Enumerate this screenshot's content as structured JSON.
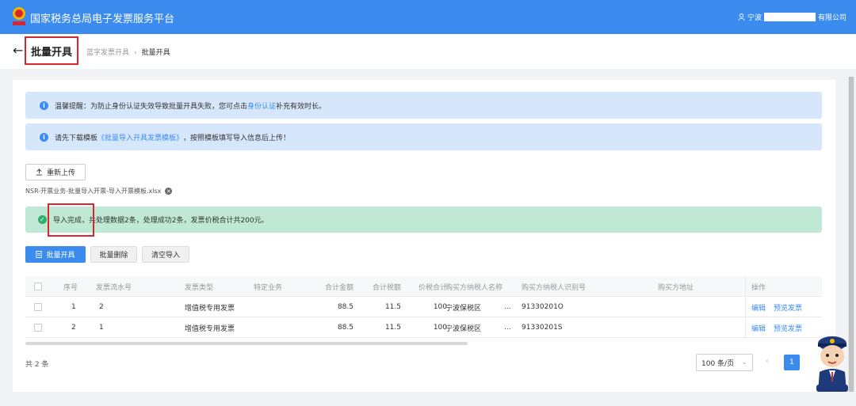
{
  "header": {
    "app_title": "国家税务总局电子发票服务平台",
    "user_prefix": "宁波",
    "user_suffix": "有限公司"
  },
  "subheader": {
    "back_icon": "←",
    "page_title": "批量开具",
    "breadcrumb": [
      "蓝字发票开具",
      "批量开具"
    ]
  },
  "alerts": {
    "tip_prefix": "温馨提醒：为防止身份认证失效导致批量开具失败，您可点击",
    "tip_link": "身份认证",
    "tip_suffix": "补充有效时长。",
    "template_prefix": "请先下载模板",
    "template_link": "《批量导入开具发票模板》",
    "template_suffix": "，按照模板填写导入信息后上传！"
  },
  "upload": {
    "reupload_label": "重新上传",
    "filename": "NSR-开票业务-批量导入开票-导入开票模板.xlsx"
  },
  "import_result": {
    "message": "导入完成，共处理数据2条，处理成功2条，发票价税合计共200元。"
  },
  "actions": {
    "batch_issue": "批量开具",
    "batch_delete": "批量删除",
    "clear_import": "清空导入"
  },
  "table": {
    "headers": [
      "序号",
      "发票流水号",
      "发票类型",
      "特定业务",
      "合计金额",
      "合计税额",
      "价税合计",
      "购买方纳税人名称",
      "购买方纳税人识别号",
      "购买方地址",
      "操作"
    ],
    "rows": [
      {
        "index": "1",
        "serial": "2",
        "type": "增值税专用发票",
        "special": "",
        "amount": "88.5",
        "tax": "11.5",
        "total": "100",
        "buyer_name": "宁波保税区",
        "buyer_name_more": "...",
        "buyer_id": "91330201O",
        "address": "",
        "edit": "编辑",
        "preview": "预览发票"
      },
      {
        "index": "2",
        "serial": "1",
        "type": "增值税专用发票",
        "special": "",
        "amount": "88.5",
        "tax": "11.5",
        "total": "100",
        "buyer_name": "宁波保税区",
        "buyer_name_more": "...",
        "buyer_id": "91330201S",
        "address": "",
        "edit": "编辑",
        "preview": "预览发票"
      }
    ]
  },
  "footer": {
    "total": "共 2 条",
    "page_size": "100 条/页",
    "current_page": "1"
  },
  "colors": {
    "primary": "#3c8cf0",
    "highlight": "#d9262c",
    "success_bg": "#bfe9d4",
    "info_bg": "#d6e7fb"
  }
}
